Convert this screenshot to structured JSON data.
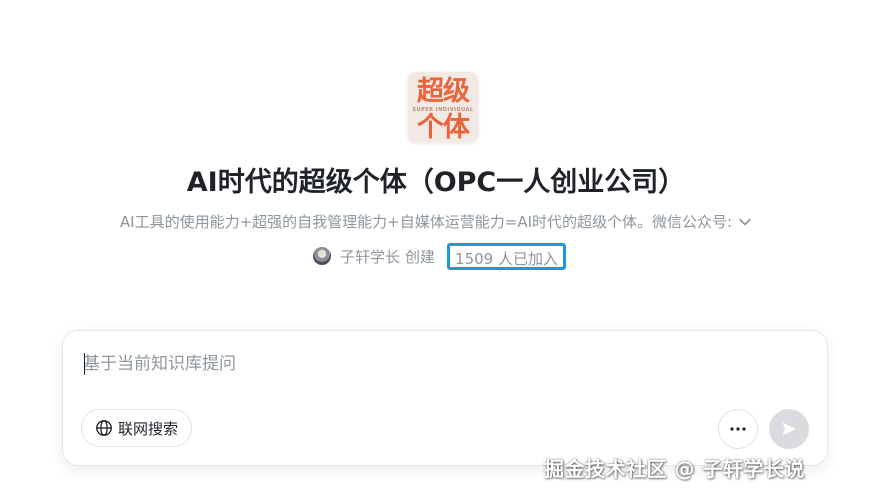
{
  "logo": {
    "line1": "超级",
    "line2": "SUPER INDIVIDUAL",
    "line3": "个体",
    "colors": {
      "text": "#e8643a",
      "background": "#f2e9e4"
    }
  },
  "title": "AI时代的超级个体（OPC一人创业公司）",
  "description": "AI工具的使用能力+超强的自我管理能力+自媒体运营能力=AI时代的超级个体。微信公众号:",
  "creator": {
    "name": "子轩学长",
    "suffix": "创建"
  },
  "members": "1509 人已加入",
  "chat": {
    "placeholder": "基于当前知识库提问",
    "value": "",
    "web_search_label": "联网搜索"
  },
  "icons": {
    "expand": "chevron-down-icon",
    "globe": "globe-icon",
    "more": "more-icon",
    "send": "send-icon"
  },
  "colors": {
    "highlight_border": "#1a97e8",
    "muted_text": "#8f959e",
    "send_disabled": "#d9dbde"
  },
  "watermark": "掘金技术社区 @ 子轩学长说"
}
